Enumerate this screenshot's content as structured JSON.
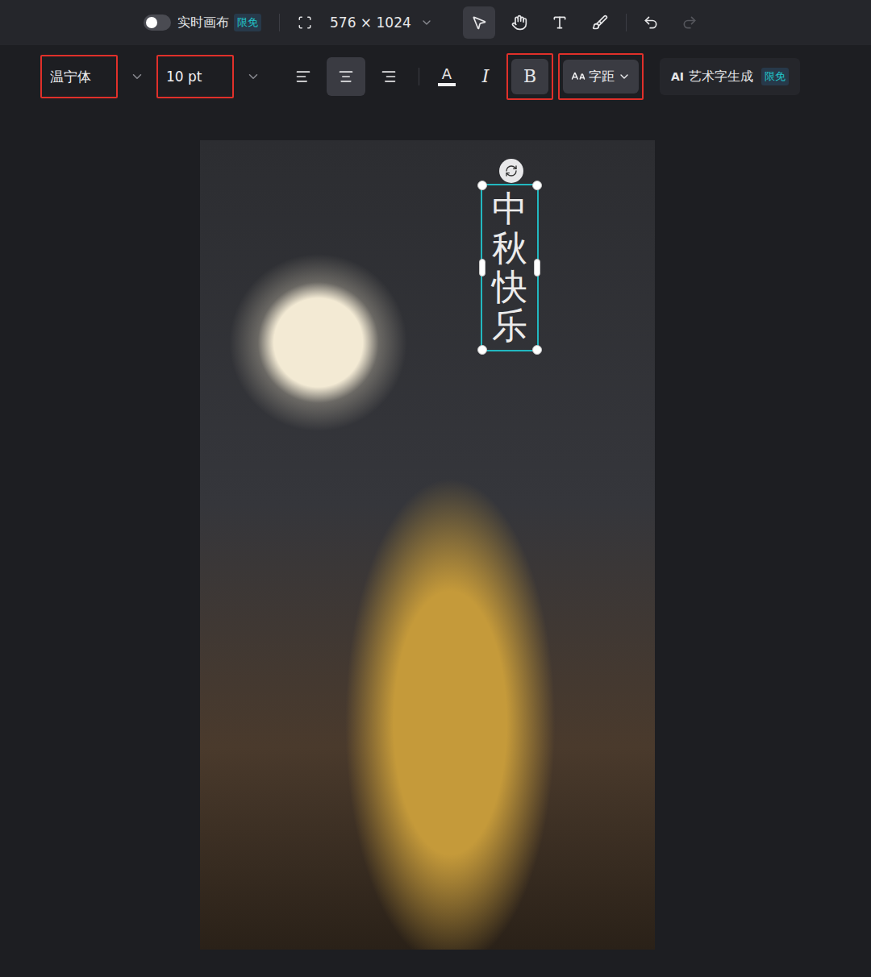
{
  "toolbar": {
    "live_canvas": {
      "label": "实时画布",
      "badge": "限免",
      "on": false
    },
    "size": "576 × 1024",
    "tools": [
      {
        "name": "select",
        "selected": true
      },
      {
        "name": "hand",
        "selected": false
      },
      {
        "name": "text",
        "selected": false
      },
      {
        "name": "brush",
        "selected": false
      }
    ],
    "undo": {
      "disabled": false
    },
    "redo": {
      "disabled": true
    }
  },
  "text_toolbar": {
    "font": {
      "value": "温宁体",
      "highlighted": true
    },
    "size": {
      "value": "10 pt",
      "highlighted": true
    },
    "align": [
      {
        "name": "left",
        "selected": false
      },
      {
        "name": "center",
        "selected": true
      },
      {
        "name": "right",
        "selected": false
      }
    ],
    "text_color": {
      "glyph": "A"
    },
    "italic": {
      "glyph": "I",
      "selected": false
    },
    "bold": {
      "glyph": "B",
      "selected": true,
      "highlighted": true
    },
    "spacing": {
      "label": "字距",
      "highlighted": true
    },
    "ai_button": {
      "prefix": "AI",
      "label": "艺术字生成",
      "badge": "限免"
    }
  },
  "canvas": {
    "text": "中秋快乐",
    "selected": true
  }
}
